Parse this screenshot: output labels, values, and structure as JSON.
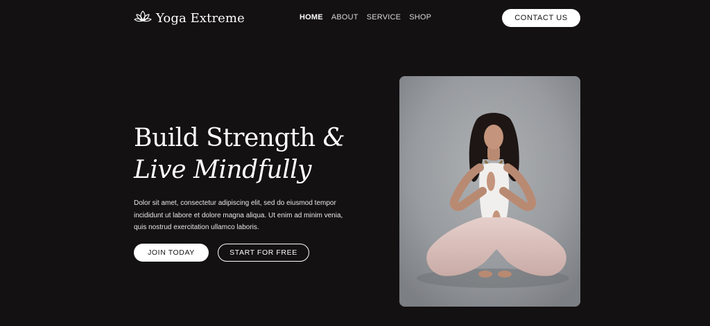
{
  "brand": {
    "name": "Yoga Extreme",
    "logo_icon": "lotus-icon"
  },
  "nav": {
    "items": [
      {
        "label": "HOME",
        "active": true
      },
      {
        "label": "ABOUT",
        "active": false
      },
      {
        "label": "SERVICE",
        "active": false
      },
      {
        "label": "SHOP",
        "active": false
      }
    ],
    "contact_label": "CONTACT US"
  },
  "hero": {
    "title_line1": "Build Strength",
    "title_amp": "&",
    "title_line2": "Live Mindfully",
    "description": "Dolor sit amet, consectetur adipiscing elit, sed do eiusmod tempor incididunt ut labore et dolore magna aliqua. Ut enim ad minim venia, quis nostrud exercitation ullamco laboris.",
    "primary_cta": "JOIN TODAY",
    "secondary_cta": "START FOR FREE"
  },
  "colors": {
    "background": "#131112",
    "text": "#ffffff",
    "button_fill": "#ffffff"
  }
}
